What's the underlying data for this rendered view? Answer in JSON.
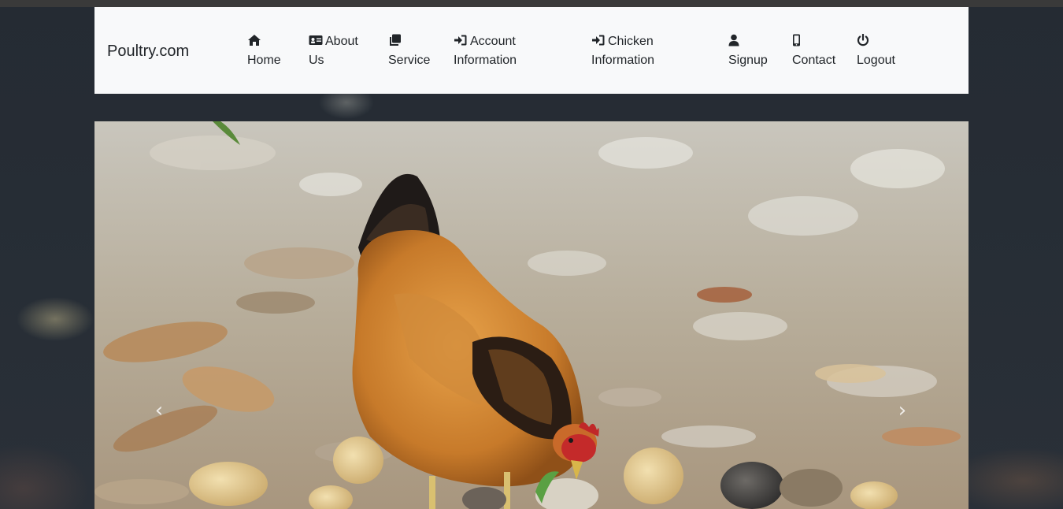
{
  "navbar": {
    "brand": "Poultry.com",
    "items": [
      {
        "icon": "home-icon",
        "line1": "",
        "line2": "Home"
      },
      {
        "icon": "id-card-icon",
        "line1": "About",
        "line2": "Us"
      },
      {
        "icon": "clone-icon",
        "line1": "",
        "line2": "Service"
      },
      {
        "icon": "sign-in-icon",
        "line1": "Account",
        "line2": "Information"
      },
      {
        "icon": "sign-in-icon",
        "line1": "Chicken",
        "line2": "Information"
      },
      {
        "icon": "user-icon",
        "line1": "",
        "line2": "Signup"
      },
      {
        "icon": "mobile-icon",
        "line1": "",
        "line2": "Contact"
      },
      {
        "icon": "power-icon",
        "line1": "",
        "line2": "Logout"
      }
    ]
  },
  "carousel": {
    "image": "hen-with-chicks-photo",
    "prev_icon": "‹",
    "next_icon": "›"
  },
  "colors": {
    "navbar_bg": "#f8f9fa",
    "page_bg": "#262d35",
    "text": "#212529"
  }
}
